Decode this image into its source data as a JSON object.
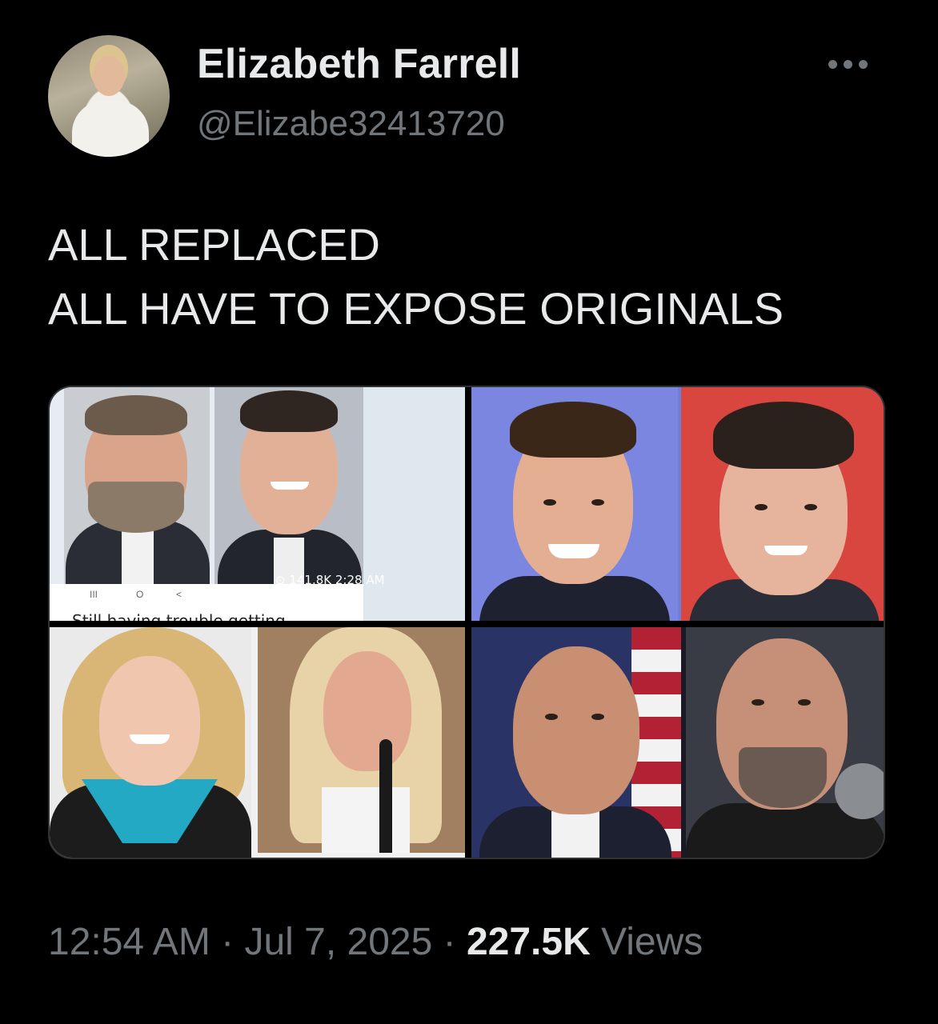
{
  "author": {
    "name": "Elizabeth Farrell",
    "handle": "@Elizabe32413720",
    "avatar_icon": "profile-photo"
  },
  "more_icon": "more-horizontal-icon",
  "post": {
    "lines": [
      "ALL REPLACED",
      "ALL HAVE TO EXPOSE ORIGINALS"
    ]
  },
  "media": {
    "overlay_stats": "⊙ 141.8K 2:28 AM",
    "cut_text": "Still having trouble getting",
    "nav_glyphs": [
      "III",
      "O",
      "<"
    ]
  },
  "footer": {
    "time": "12:54 AM",
    "separator": " · ",
    "date": "Jul 7, 2025",
    "views_count": "227.5K",
    "views_label": " Views"
  },
  "colors": {
    "background": "#000000",
    "text_primary": "#e7e9ea",
    "text_secondary": "#71767b"
  }
}
